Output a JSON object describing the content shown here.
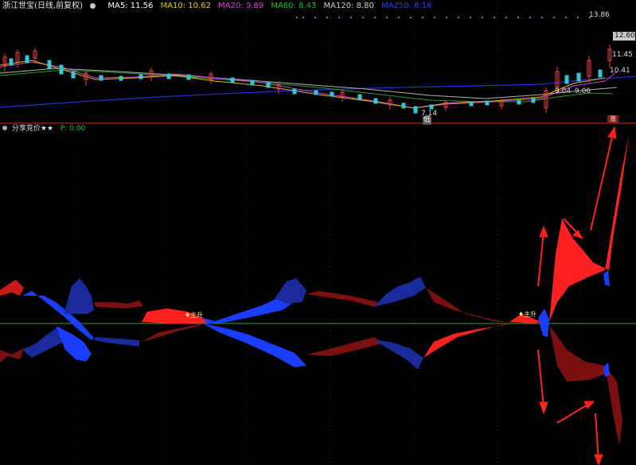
{
  "header": {
    "title": "浙江世宝(日线,前复权)",
    "ma": [
      {
        "label": "MA5: 11.56",
        "color": "#ffffff"
      },
      {
        "label": "MA10: 10.62",
        "color": "#f0d000"
      },
      {
        "label": "MA20: 9.89",
        "color": "#e040e0"
      },
      {
        "label": "MA60: 8.43",
        "color": "#20c020"
      },
      {
        "label": "MA120: 8.80",
        "color": "#cfcfcf"
      },
      {
        "label": "MA250: 8.18",
        "color": "#2040ff"
      }
    ]
  },
  "price_panel": {
    "high_label": "13.86",
    "price_labels": [
      "12.60",
      "11.45",
      "10.41",
      "9.04",
      "9.06",
      "7.14"
    ],
    "low_marker": "低"
  },
  "indicator_panel": {
    "header_name": "分享竞价★★",
    "header_value": "P: 0.00",
    "signal_label": "主升",
    "corner_badge": "涨"
  },
  "colors": {
    "red": "#ff2020",
    "dark_red": "#8a1010",
    "blue": "#1a3dff",
    "dark_blue": "#10208a",
    "zero_line": "#2ea82e",
    "divider": "#8a1b1b"
  }
}
